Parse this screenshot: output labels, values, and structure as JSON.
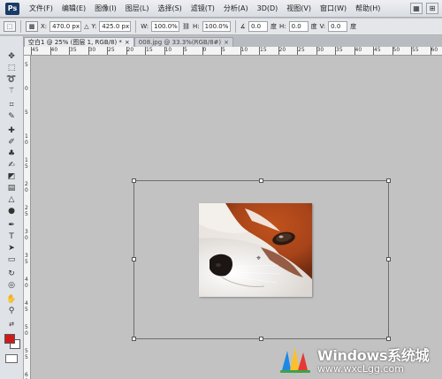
{
  "app": {
    "logo": "Ps"
  },
  "menu": [
    "文件(F)",
    "编辑(E)",
    "图像(I)",
    "图层(L)",
    "选择(S)",
    "滤镜(T)",
    "分析(A)",
    "3D(D)",
    "视图(V)",
    "窗口(W)",
    "帮助(H)"
  ],
  "options": {
    "x_label": "X:",
    "x_value": "470.0 px",
    "y_label": "Y:",
    "y_value": "425.0 px",
    "w_label": "W:",
    "w_value": "100.0%",
    "h_label": "H:",
    "h_value": "100.0%",
    "angle_value": "0.0",
    "angle_unit": "度",
    "hskew_label": "H:",
    "hskew_value": "0.0",
    "hskew_unit": "度",
    "vskew_label": "V:",
    "vskew_value": "0.0",
    "vskew_unit": "度"
  },
  "tabs": [
    {
      "label": "空白1 @ 25% (图层 1, RGB/8) *",
      "close": "×"
    },
    {
      "label": "008.jpg @ 33.3%(RGB/8#)",
      "close": "×"
    }
  ],
  "ruler_h_labels": [
    "45",
    "40",
    "35",
    "30",
    "25",
    "20",
    "15",
    "10",
    "5",
    "0",
    "5",
    "10",
    "15",
    "20",
    "25",
    "30",
    "35",
    "40",
    "45",
    "50",
    "55",
    "60"
  ],
  "ruler_v_labels": [
    "5",
    "0",
    "5",
    "10",
    "15",
    "20",
    "25",
    "30",
    "35",
    "40",
    "45",
    "50",
    "55",
    "60"
  ],
  "colors": {
    "foreground": "#d01a1a",
    "background": "#ffffff",
    "canvas": "#c2c2c2"
  },
  "watermark": {
    "title": "Windows系统城",
    "url": "www.wxcLgg.com"
  }
}
